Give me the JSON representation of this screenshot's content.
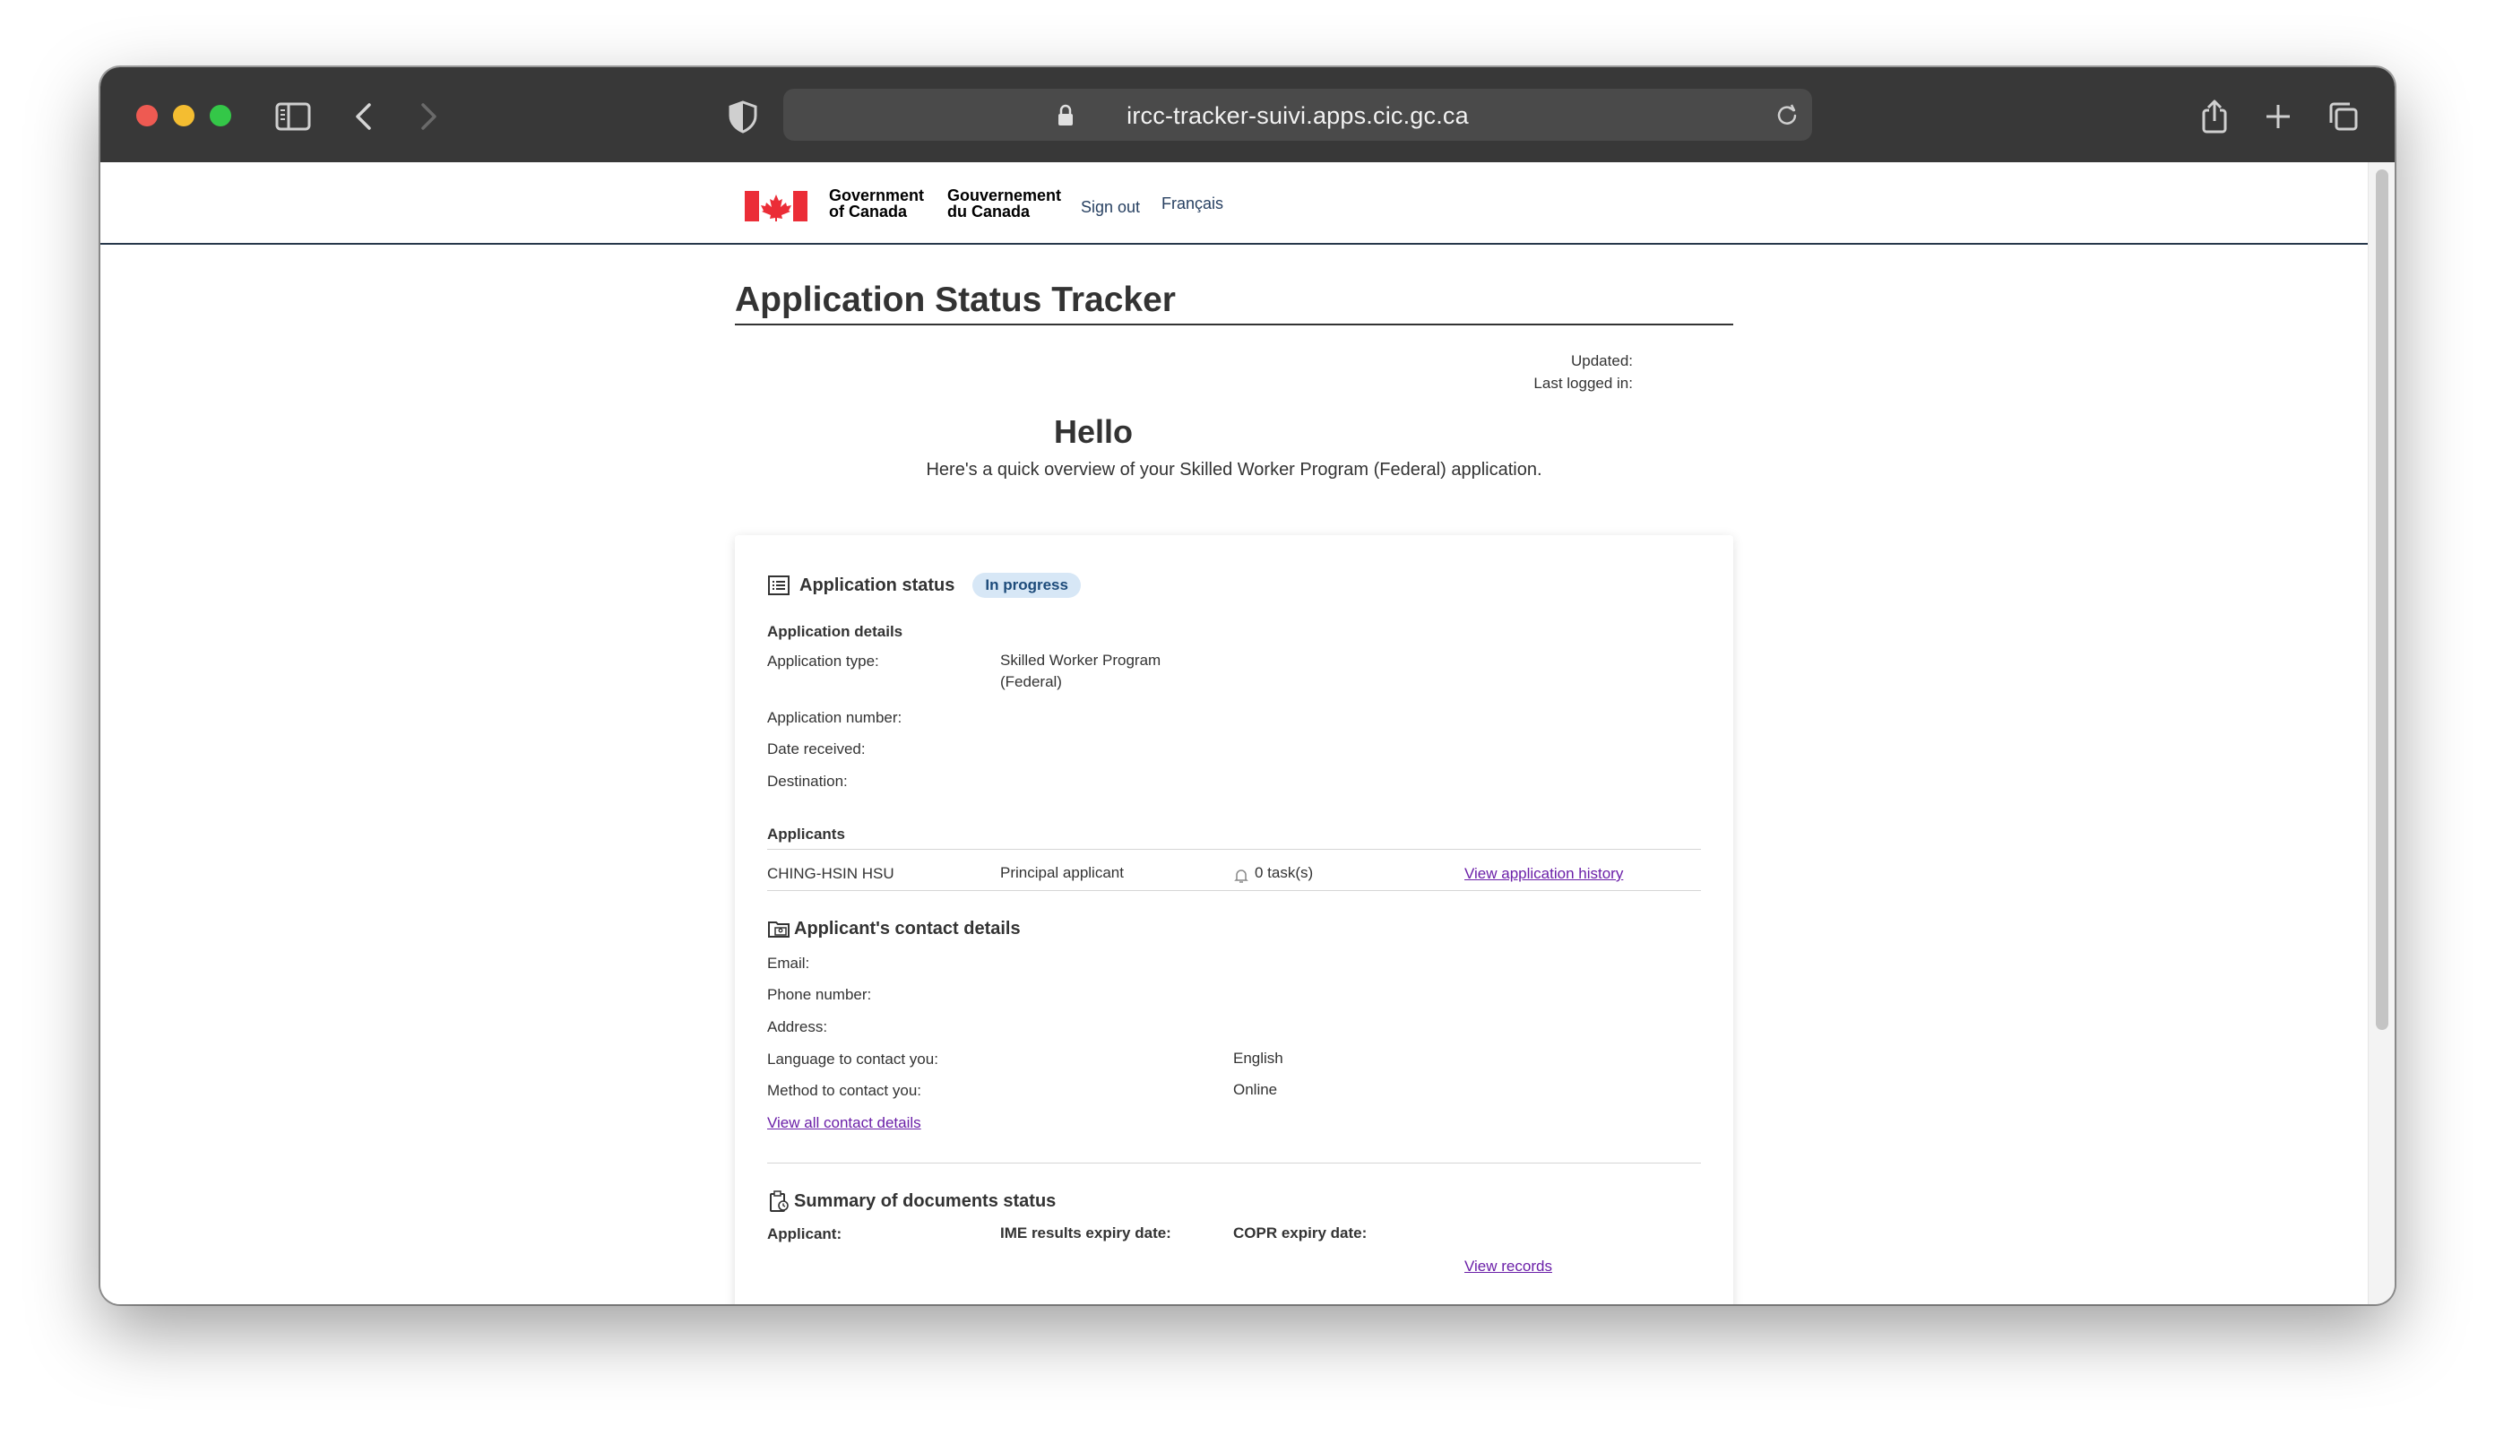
{
  "browser": {
    "url": "ircc-tracker-suivi.apps.cic.gc.ca"
  },
  "header": {
    "gov_en_line1": "Government",
    "gov_en_line2": "of Canada",
    "gov_fr_line1": "Gouvernement",
    "gov_fr_line2": "du Canada",
    "sign_out": "Sign out",
    "language_toggle": "Français"
  },
  "main": {
    "title": "Application Status Tracker",
    "updated_label": "Updated:",
    "last_logged_label": "Last logged in:",
    "greeting": "Hello",
    "overview": "Here's a quick overview of your Skilled Worker Program (Federal) application."
  },
  "status_section": {
    "heading": "Application status",
    "badge": "In progress",
    "details_heading": "Application details",
    "type_label": "Application type:",
    "type_value_line1": "Skilled Worker Program",
    "type_value_line2": "(Federal)",
    "number_label": "Application number:",
    "date_label": "Date received:",
    "destination_label": "Destination:",
    "applicants_heading": "Applicants",
    "applicant": {
      "name": "CHING-HSIN HSU",
      "role": "Principal applicant",
      "tasks": "0 task(s)",
      "history_link": "View application history"
    }
  },
  "contact_section": {
    "heading": "Applicant's contact details",
    "email_label": "Email:",
    "phone_label": "Phone number:",
    "address_label": "Address:",
    "language_label": "Language to contact you:",
    "language_value": "English",
    "method_label": "Method to contact you:",
    "method_value": "Online",
    "view_all_link": "View all contact details"
  },
  "documents_section": {
    "heading": "Summary of documents status",
    "col_applicant": "Applicant:",
    "col_ime": "IME results expiry date:",
    "col_copr": "COPR expiry date:",
    "records_link": "View records"
  },
  "colors": {
    "gc_red": "#eb2d37",
    "gc_blue": "#26374a",
    "link_purple": "#6b1fa8",
    "badge_bg": "#d7e7f6"
  }
}
